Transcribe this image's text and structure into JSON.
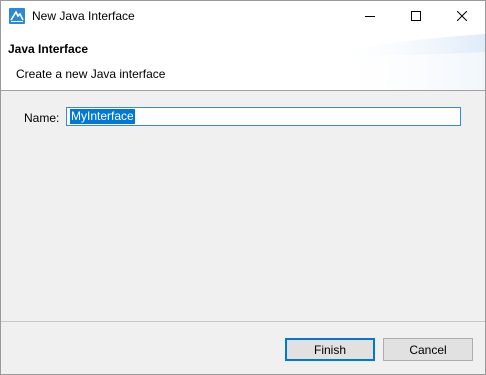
{
  "window": {
    "title": "New Java Interface",
    "icon": "java-wizard-icon",
    "controls": [
      "minimize-icon",
      "maximize-icon",
      "close-icon"
    ]
  },
  "header": {
    "title": "Java Interface",
    "description": "Create a new Java interface"
  },
  "form": {
    "name_label": "Name:",
    "name_value": "MyInterface"
  },
  "buttons": {
    "finish": "Finish",
    "cancel": "Cancel"
  },
  "colors": {
    "selection": "#0078d7",
    "focus_border": "#3c88d6",
    "dialog_bg": "#f0f0f0"
  }
}
